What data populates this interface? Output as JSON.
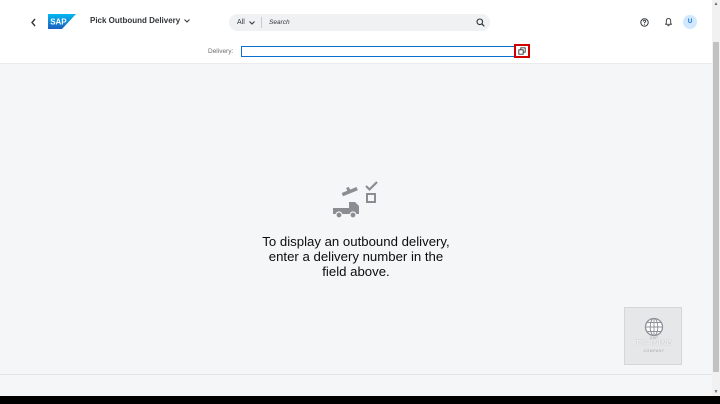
{
  "header": {
    "app_title": "Pick Outbound Delivery",
    "search": {
      "scope": "All",
      "placeholder": "Search"
    },
    "avatar_initial": "U",
    "icons": [
      "back-icon",
      "chevron-down-icon",
      "search-icon",
      "help-icon",
      "notification-bell-icon"
    ]
  },
  "delivery": {
    "label": "Delivery:",
    "value": "",
    "value_help_icon": "value-help-icon"
  },
  "empty_state": {
    "message_line1": "To display an outbound delivery,",
    "message_line2": "enter a delivery number in the",
    "message_line3": "field above.",
    "illustration": "truck-illustration"
  },
  "watermark": {
    "line_top": "SAP",
    "line_main": "TRAINING",
    "line_bottom": "COMPANY"
  },
  "colors": {
    "brand_blue": "#0a6ed1",
    "highlight_red": "#d00000",
    "background": "#f5f6f7"
  }
}
